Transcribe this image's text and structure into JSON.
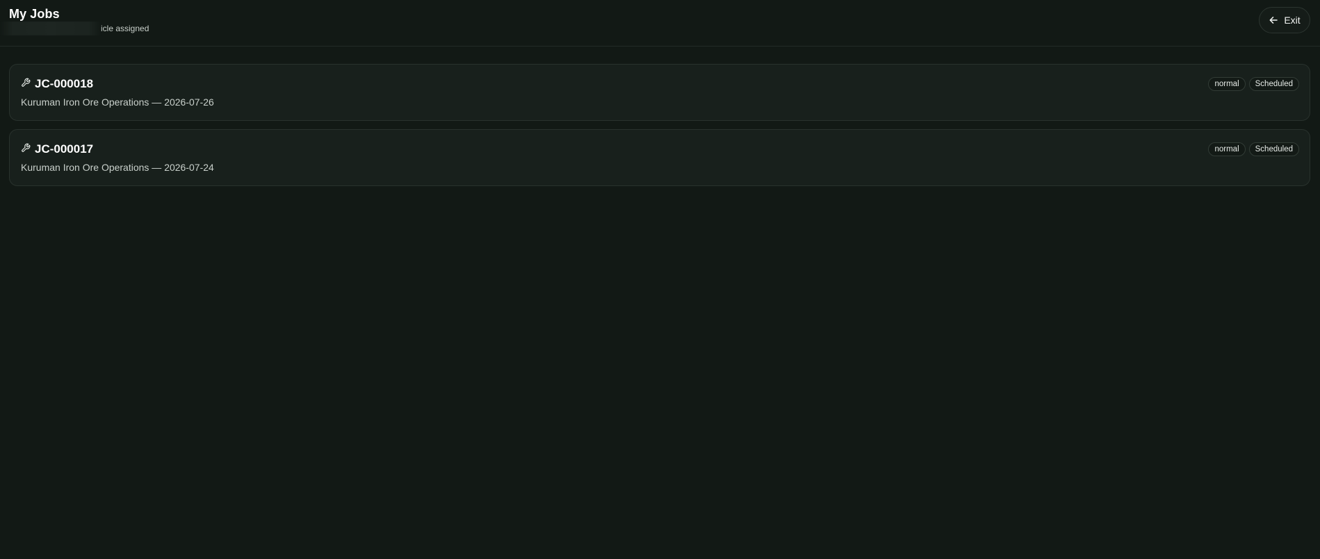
{
  "header": {
    "title": "My Jobs",
    "subtitle_visible": "icle assigned",
    "exit_label": "Exit",
    "exit_icon": "arrow-left-icon"
  },
  "jobs": [
    {
      "id": "JC-000018",
      "icon": "wrench-icon",
      "description": "Kuruman Iron Ore Operations — 2026-07-26",
      "priority": "normal",
      "status": "Scheduled"
    },
    {
      "id": "JC-000017",
      "icon": "wrench-icon",
      "description": "Kuruman Iron Ore Operations — 2026-07-24",
      "priority": "normal",
      "status": "Scheduled"
    }
  ],
  "colors": {
    "background": "#121915",
    "card": "#18201c",
    "border": "#29322d",
    "text": "#f2f4f2",
    "muted_text": "#c9d0cb"
  }
}
